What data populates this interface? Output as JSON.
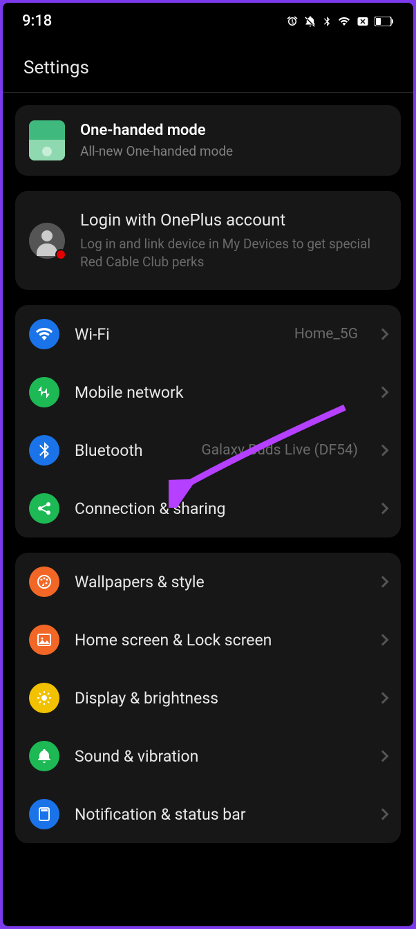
{
  "status": {
    "time": "9:18"
  },
  "pageTitle": "Settings",
  "promo": {
    "title": "One-handed mode",
    "subtitle": "All-new One-handed mode"
  },
  "account": {
    "title": "Login with OnePlus account",
    "subtitle": "Log in and link device in My Devices to get special Red Cable Club perks"
  },
  "group1": [
    {
      "icon": "wifi",
      "color": "ic-blue",
      "label": "Wi-Fi",
      "value": "Home_5G"
    },
    {
      "icon": "mobile",
      "color": "ic-green",
      "label": "Mobile network",
      "value": ""
    },
    {
      "icon": "bluetooth",
      "color": "ic-blue",
      "label": "Bluetooth",
      "value": "Galaxy Buds Live (DF54)"
    },
    {
      "icon": "share",
      "color": "ic-green",
      "label": "Connection & sharing",
      "value": ""
    }
  ],
  "group2": [
    {
      "icon": "palette",
      "color": "ic-orange",
      "label": "Wallpapers & style",
      "value": ""
    },
    {
      "icon": "image",
      "color": "ic-orange",
      "label": "Home screen & Lock screen",
      "value": ""
    },
    {
      "icon": "sun",
      "color": "ic-yellow",
      "label": "Display & brightness",
      "value": ""
    },
    {
      "icon": "bell",
      "color": "ic-green",
      "label": "Sound & vibration",
      "value": ""
    },
    {
      "icon": "notification",
      "color": "ic-blue",
      "label": "Notification & status bar",
      "value": ""
    }
  ],
  "annotation": {
    "color": "#b540ff"
  }
}
